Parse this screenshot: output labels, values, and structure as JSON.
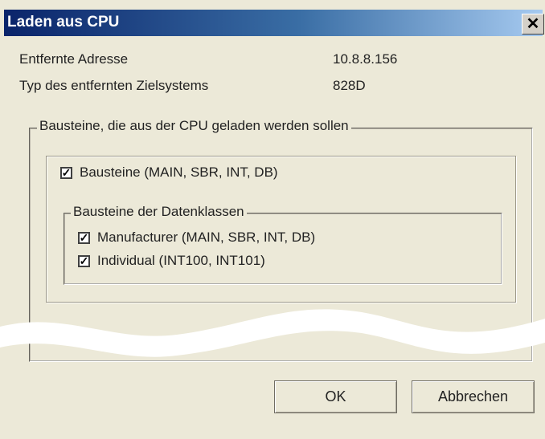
{
  "window": {
    "title": "Laden aus CPU",
    "close_icon": "close-icon"
  },
  "info": {
    "remote_address_label": "Entfernte Adresse",
    "remote_address_value": "10.8.8.156",
    "target_type_label": "Typ des entfernten Zielsystems",
    "target_type_value": "828D"
  },
  "blocks_group": {
    "title": "Bausteine, die aus der CPU geladen werden sollen",
    "main_checkbox": {
      "label": "Bausteine (MAIN, SBR, INT, DB)",
      "checked": true
    },
    "dataclass_group": {
      "title": "Bausteine der Datenklassen",
      "items": [
        {
          "label": "Manufacturer (MAIN, SBR, INT, DB)",
          "checked": true
        },
        {
          "label": "Individual (INT100, INT101)",
          "checked": true
        }
      ]
    }
  },
  "buttons": {
    "ok": "OK",
    "cancel": "Abbrechen"
  }
}
